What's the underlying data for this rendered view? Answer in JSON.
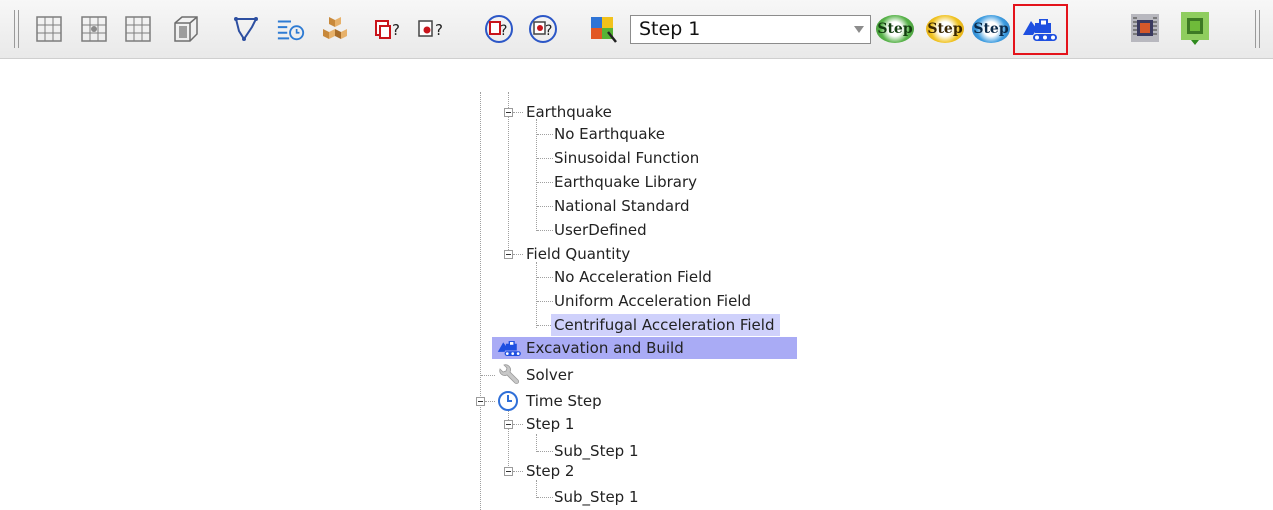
{
  "toolbar": {
    "step_combo": {
      "value": "Step 1"
    },
    "step_buttons": [
      "Step",
      "Step",
      "Step"
    ]
  },
  "tree": {
    "earthquake": {
      "label": "Earthquake",
      "children": [
        "No Earthquake",
        "Sinusoidal Function",
        "Earthquake Library",
        "National Standard",
        "UserDefined"
      ]
    },
    "field_quantity": {
      "label": "Field Quantity",
      "children": [
        "No Acceleration Field",
        "Uniform Acceleration Field",
        "Centrifugal Acceleration Field"
      ]
    },
    "excavation": "Excavation and Build",
    "solver": "Solver",
    "time_step": {
      "label": "Time Step",
      "steps": [
        {
          "label": "Step 1",
          "sub": "Sub_Step 1"
        },
        {
          "label": "Step 2",
          "sub": "Sub_Step 1"
        }
      ]
    }
  },
  "colors": {
    "selection": "#cfd1fb",
    "active_selection": "#a9abf5",
    "highlight_border": "#e4131b"
  }
}
